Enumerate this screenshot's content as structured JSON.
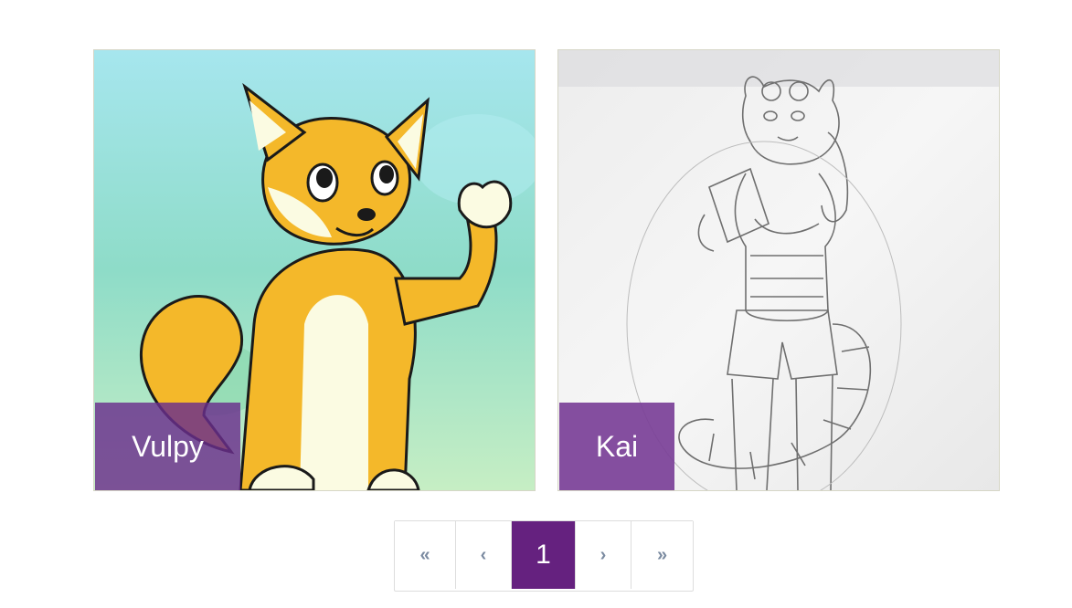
{
  "gallery": {
    "items": [
      {
        "name": "Vulpy",
        "image_icon": "fox-character-drawing"
      },
      {
        "name": "Kai",
        "image_icon": "red-panda-pencil-sketch"
      }
    ]
  },
  "pagination": {
    "first": "«",
    "prev": "‹",
    "current": "1",
    "next": "›",
    "last": "»"
  },
  "colors": {
    "accent": "#65217f",
    "tag_overlay": "#6a2e8c"
  }
}
